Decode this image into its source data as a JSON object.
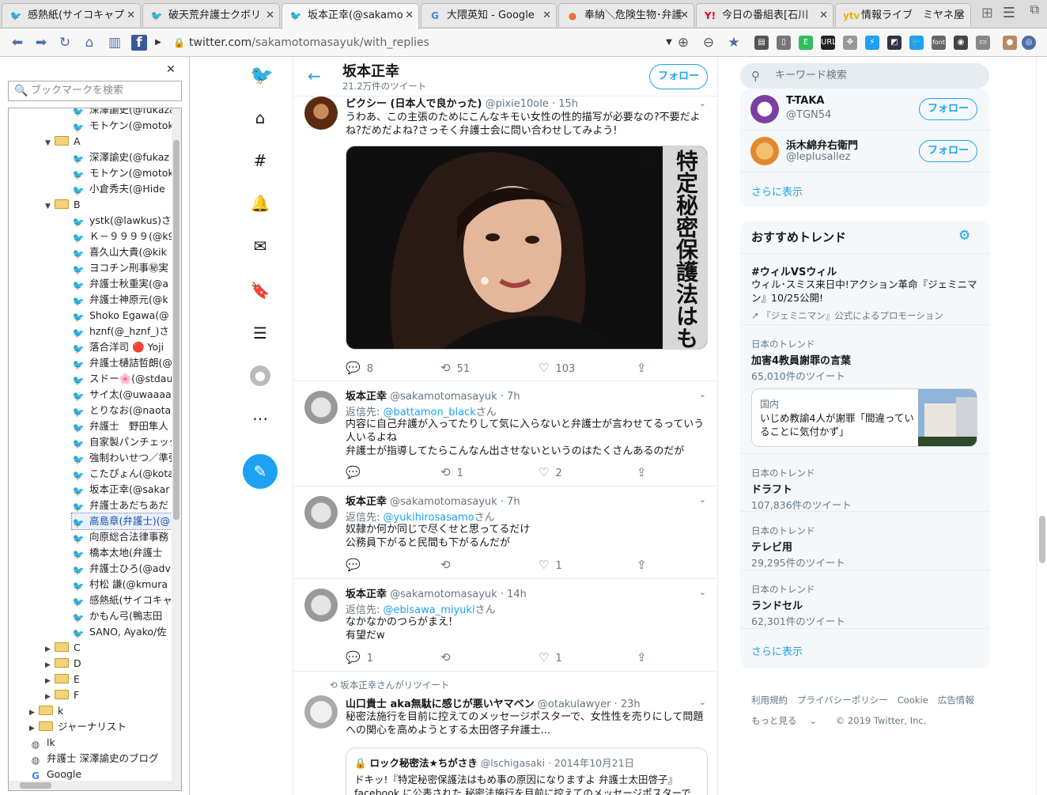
{
  "tabs": [
    {
      "label": "感熱紙(サイコキャプ",
      "icon": "twitter-icon",
      "color": "#1da1f2"
    },
    {
      "label": "破天荒弁護士クボリ",
      "icon": "twitter-icon",
      "color": "#1da1f2"
    },
    {
      "label": "坂本正幸(@sakamo",
      "icon": "twitter-icon",
      "color": "#1da1f2"
    },
    {
      "label": "大隈英知 - Google",
      "icon": "google-icon",
      "color": "#4285f4"
    },
    {
      "label": "奉納＼危険生物･弁護",
      "icon": "hatena-icon",
      "color": "#e8733a"
    },
    {
      "label": "今日の番組表[石川",
      "icon": "yahoo-icon",
      "color": "#e10027"
    },
    {
      "label": "情報ライブ　ミヤネ屋",
      "icon": "ytv-icon",
      "color": "#e8b400"
    }
  ],
  "url": {
    "host": "twitter.com",
    "path": "/sakamotomasayuk/with_replies"
  },
  "bookmarks": {
    "search_placeholder": "ブックマークを検索",
    "items": [
      {
        "label": "深澤諭史(@fukazawa",
        "type": "tw",
        "indent": 2
      },
      {
        "label": "モトケン(@motoken_",
        "type": "tw",
        "indent": 2
      },
      {
        "label": "A",
        "type": "folder-open",
        "indent": 1
      },
      {
        "label": "深澤諭史(@fukaz",
        "type": "tw",
        "indent": 2
      },
      {
        "label": "モトケン(@motok",
        "type": "tw",
        "indent": 2
      },
      {
        "label": "小倉秀夫(@Hide",
        "type": "tw",
        "indent": 2
      },
      {
        "label": "B",
        "type": "folder-open",
        "indent": 1
      },
      {
        "label": "ystk(@lawkus)さ",
        "type": "tw",
        "indent": 2
      },
      {
        "label": "Ｋ－９９９９(@k9",
        "type": "tw",
        "indent": 2
      },
      {
        "label": "喜久山大貴(@kik",
        "type": "tw",
        "indent": 2
      },
      {
        "label": "ヨコチン刑事㊙実",
        "type": "tw",
        "indent": 2
      },
      {
        "label": "弁護士秋重実(@a",
        "type": "tw",
        "indent": 2
      },
      {
        "label": "弁護士神原元(@k",
        "type": "tw",
        "indent": 2
      },
      {
        "label": "Shoko Egawa(@",
        "type": "tw",
        "indent": 2
      },
      {
        "label": "hznf(@_hznf_)さ",
        "type": "tw",
        "indent": 2
      },
      {
        "label": "落合洋司 🔴 Yoji",
        "type": "tw",
        "indent": 2
      },
      {
        "label": "弁護士樋詰哲朗(@",
        "type": "tw",
        "indent": 2
      },
      {
        "label": "スドー🌸(@stdau",
        "type": "tw",
        "indent": 2
      },
      {
        "label": "サイ太(@uwaaaa)",
        "type": "tw",
        "indent": 2
      },
      {
        "label": "とりなお(@naotar",
        "type": "tw",
        "indent": 2
      },
      {
        "label": "弁護士　野田隼人",
        "type": "tw",
        "indent": 2
      },
      {
        "label": "自家製パンチェッタ",
        "type": "tw",
        "indent": 2
      },
      {
        "label": "強制わいせつ／準強",
        "type": "tw",
        "indent": 2
      },
      {
        "label": "こたぴょん(@kota",
        "type": "tw",
        "indent": 2
      },
      {
        "label": "坂本正幸(@sakar",
        "type": "tw",
        "indent": 2
      },
      {
        "label": "弁護士あだちあだ",
        "type": "tw",
        "indent": 2
      },
      {
        "label": "高島章(弁護士)(@",
        "type": "tw",
        "indent": 2,
        "selected": true
      },
      {
        "label": "向原総合法律事務",
        "type": "tw",
        "indent": 2
      },
      {
        "label": "橋本太地(弁護士",
        "type": "tw",
        "indent": 2
      },
      {
        "label": "弁護士ひろ(@adv",
        "type": "tw",
        "indent": 2
      },
      {
        "label": "村松 謙(@kmura",
        "type": "tw",
        "indent": 2
      },
      {
        "label": "感熱紙(サイコキャ",
        "type": "tw",
        "indent": 2
      },
      {
        "label": "かもん弓(鴨志田",
        "type": "tw",
        "indent": 2
      },
      {
        "label": "SANO, Ayako/佐",
        "type": "tw",
        "indent": 2
      },
      {
        "label": "C",
        "type": "folder",
        "indent": 1
      },
      {
        "label": "D",
        "type": "folder",
        "indent": 1
      },
      {
        "label": "E",
        "type": "folder",
        "indent": 1
      },
      {
        "label": "F",
        "type": "folder",
        "indent": 1
      },
      {
        "label": "k",
        "type": "folder",
        "indent": 0
      },
      {
        "label": "ジャーナリスト",
        "type": "folder",
        "indent": 0
      },
      {
        "label": "lk",
        "type": "globe",
        "indent": 0
      },
      {
        "label": "弁護士 深澤諭史のブログ",
        "type": "globe",
        "indent": 0
      },
      {
        "label": "Google",
        "type": "google",
        "indent": 0
      }
    ]
  },
  "profile": {
    "name": "坂本正幸",
    "tweet_count": "21.2万件のツイート",
    "follow_label": "フォロー"
  },
  "tweets": [
    {
      "name": "ピクシー (日本人で良かった)",
      "handle": "@pixie10ole · 15h",
      "text": "うわあ、この主張のためにこんなキモい女性の性的描写が必要なの?不要だよね?だめだよね?さっそく弁護士会に問い合わせしてみよう!",
      "replies": "8",
      "retweets": "51",
      "likes": "103",
      "image_text": "特定秘密保護法はもめ"
    },
    {
      "name": "坂本正幸",
      "handle": "@sakamotomasayuk · 7h",
      "reply_prefix": "返信先: ",
      "reply_to": "@battamon_black",
      "reply_suffix": "さん",
      "text": "内容に自己弁護が入ってたりして気に入らないと弁護士が言わせてるっていう人いるよね\n弁護士が指導してたらこんなん出させないというのはたくさんあるのだが",
      "replies": "",
      "retweets": "1",
      "likes": "2"
    },
    {
      "name": "坂本正幸",
      "handle": "@sakamotomasayuk · 7h",
      "reply_prefix": "返信先: ",
      "reply_to": "@yukihirosasamo",
      "reply_suffix": "さん",
      "text": "奴隷か何か同じで尽くせと思ってるだけ\n公務員下がると民間も下がるんだが",
      "replies": "",
      "retweets": "",
      "likes": "1"
    },
    {
      "name": "坂本正幸",
      "handle": "@sakamotomasayuk · 14h",
      "reply_prefix": "返信先: ",
      "reply_to": "@ebisawa_miyuki",
      "reply_suffix": "さん",
      "text": "なかなかのつらがまえ!\n有望だw",
      "replies": "1",
      "retweets": "",
      "likes": "1"
    },
    {
      "retweeted_by": "坂本正幸さんがリツイート",
      "name": "山口貴士 aka無駄に感じが悪いヤマベン",
      "handle": "@otakulawyer · 23h",
      "text": "秘密法施行を目前に控えてのメッセージポスターで、女性性を売りにして問題への関心を高めようとする太田啓子弁護士...",
      "quote_name": "ロック秘密法★ちがさき",
      "quote_handle": "@lschigasaki · 2014年10月21日",
      "quote_text": "ドキッ!『特定秘密保護法はもめ事の原因になりますよ 弁護士太田啓子』facebook に公表された 秘密法施行を目前に控えてのメッセージポスターで"
    }
  ],
  "right": {
    "search_placeholder": "キーワード検索",
    "who_to_follow": [
      {
        "name": "T-TAKA",
        "handle": "@TGN54",
        "follow": "フォロー"
      },
      {
        "name": "浜木綿弁右衛門",
        "handle": "@leplusallez",
        "follow": "フォロー"
      }
    ],
    "show_more": "さらに表示",
    "trends_title": "おすすめトレンド",
    "promo": {
      "tag": "#ウィルVSウィル",
      "desc": "ウィル･スミス来日中!アクション革命『ジェミニマン』10/25公開!",
      "promoted": "『ジェミニマン』公式によるプロモーション"
    },
    "trends": [
      {
        "context": "日本のトレンド",
        "title": "加害4教員謝罪の言葉",
        "count": "65,010件のツイート"
      },
      {
        "context": "日本のトレンド",
        "title": "ドラフト",
        "count": "107,836件のツイート"
      },
      {
        "context": "日本のトレンド",
        "title": "テレビ用",
        "count": "29,295件のツイート"
      },
      {
        "context": "日本のトレンド",
        "title": "ランドセル",
        "count": "62,301件のツイート"
      }
    ],
    "news": {
      "category": "国内",
      "headline": "いじめ教諭4人が謝罪「間違っていることに気付かず」"
    },
    "show_more2": "さらに表示",
    "footer": [
      "利用規約",
      "プライバシーポリシー",
      "Cookie",
      "広告情報",
      "もっと見る",
      "© 2019 Twitter, Inc."
    ]
  }
}
